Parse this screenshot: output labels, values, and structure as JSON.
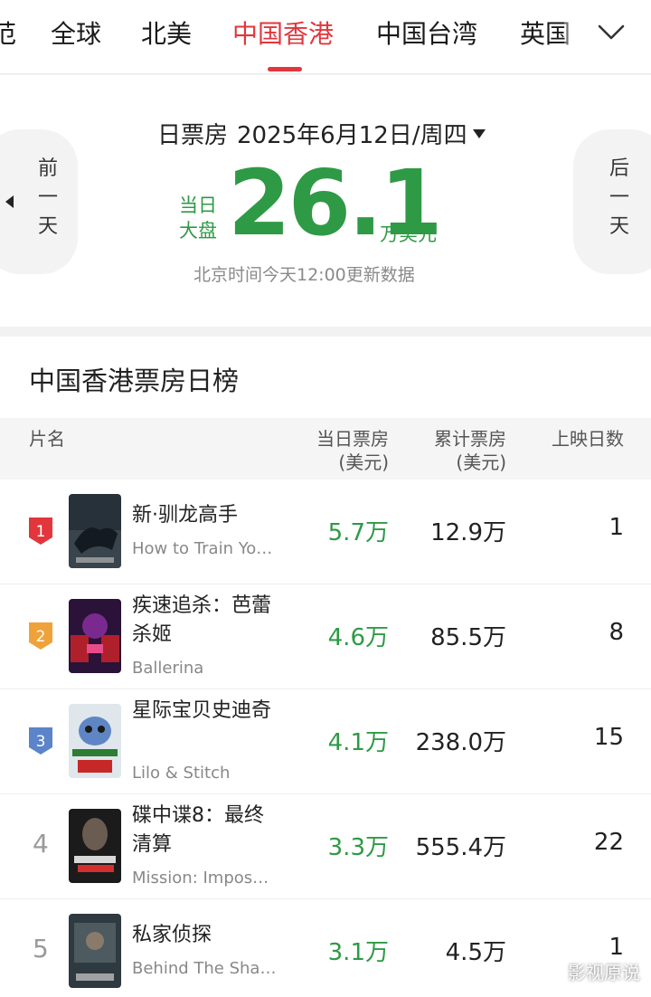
{
  "region_tabs": {
    "items": [
      "范",
      "全球",
      "北美",
      "中国香港",
      "中国台湾",
      "英国"
    ],
    "active": "中国香港"
  },
  "summary": {
    "prev_label": [
      "前",
      "一",
      "天"
    ],
    "next_label": [
      "后",
      "一",
      "天"
    ],
    "date_prefix": "日票房",
    "date": "2025年6月12日/周四",
    "total_label_line1": "当日",
    "total_label_line2": "大盘",
    "total_value": "26.1",
    "total_unit": "万美元",
    "update_note": "北京时间今天12:00更新数据",
    "accent_color": "#2e9a45"
  },
  "ranking": {
    "title": "中国香港票房日榜",
    "headers": {
      "name": "片名",
      "day_box_office": "当日票房",
      "day_box_office_unit": "(美元)",
      "total_box_office": "累计票房",
      "total_box_office_unit": "(美元)",
      "days": "上映日数"
    },
    "rows": [
      {
        "rank": "1",
        "title_cn": "新·驯龙高手",
        "title_en": "How to Train Yo…",
        "day": "5.7万",
        "total": "12.9万",
        "days": "1",
        "badge_color": "#e2363d"
      },
      {
        "rank": "2",
        "title_cn": "疾速追杀：芭蕾杀姬",
        "title_en": "Ballerina",
        "day": "4.6万",
        "total": "85.5万",
        "days": "8",
        "badge_color": "#f0a23a"
      },
      {
        "rank": "3",
        "title_cn": "星际宝贝史迪奇",
        "title_en": "Lilo & Stitch",
        "day": "4.1万",
        "total": "238.0万",
        "days": "15",
        "badge_color": "#5b84c9"
      },
      {
        "rank": "4",
        "title_cn": "碟中谍8：最终清算",
        "title_en": "Mission: Impos…",
        "day": "3.3万",
        "total": "555.4万",
        "days": "22",
        "badge_color": ""
      },
      {
        "rank": "5",
        "title_cn": "私家侦探",
        "title_en": "Behind The Sha…",
        "day": "3.1万",
        "total": "4.5万",
        "days": "1",
        "badge_color": ""
      }
    ]
  },
  "watermark": "影视原说"
}
